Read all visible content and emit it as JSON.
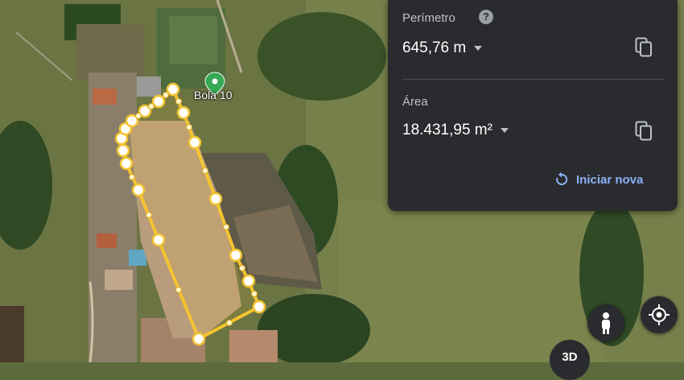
{
  "map": {
    "poi_label": "Bola 10",
    "pin_color": "#34a853",
    "measure_line_color": "#f4c430"
  },
  "panel": {
    "perimeter_label": "Perímetro",
    "perimeter_value": "645,76 m",
    "area_label": "Área",
    "area_value": "18.431,95 m²",
    "new_button_label": "Iniciar nova",
    "help_icon_text": "?"
  },
  "controls": {
    "three_d_label": "3D",
    "pegman_icon": "pegman-icon",
    "location_icon": "my-location-icon"
  },
  "colors": {
    "panel_bg": "#2a2b2e",
    "accent": "#8ab4f8"
  }
}
